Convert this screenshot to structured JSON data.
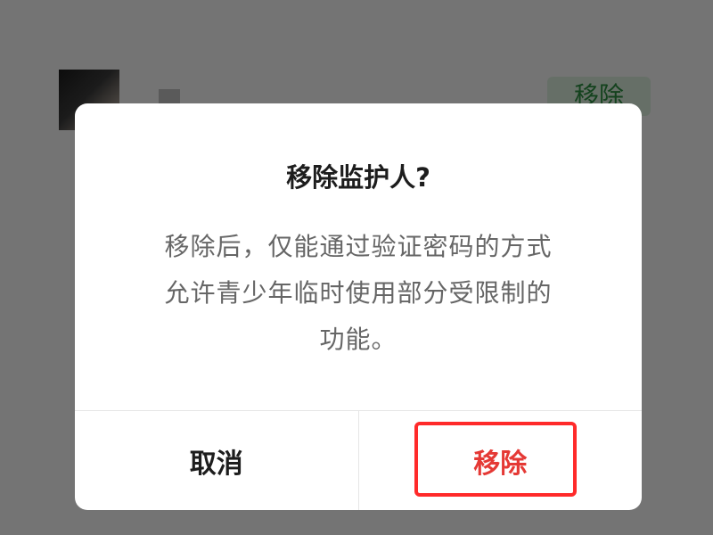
{
  "background": {
    "remove_button_label": "移除"
  },
  "dialog": {
    "title": "移除监护人?",
    "body_lines": [
      "移除后，仅能通过验证密码的方式",
      "允许青少年临时使用部分受限制的",
      "功能。"
    ],
    "cancel_label": "取消",
    "confirm_label": "移除"
  },
  "colors": {
    "overlay": "rgba(0,0,0,0.52)",
    "dialog_bg": "#ffffff",
    "title": "#1d1d1d",
    "body": "#666666",
    "divider": "#e6e6e6",
    "confirm": "#e53935",
    "highlight_border": "#ff2a2a",
    "bg_remove_button": "#d6e9d8",
    "bg_remove_text": "#2a8a3f"
  }
}
